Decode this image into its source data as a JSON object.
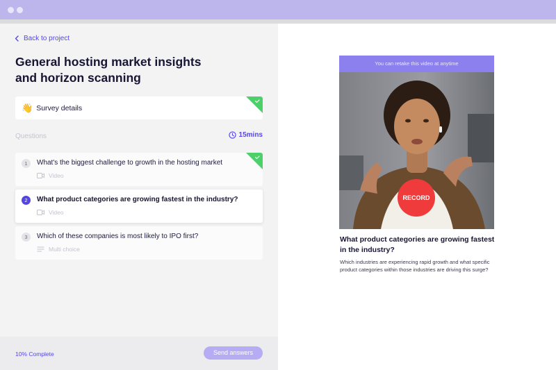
{
  "nav": {
    "back_label": "Back to project"
  },
  "survey": {
    "title": "General hosting market insights and horizon scanning",
    "details_emoji": "👋",
    "details_label": "Survey details"
  },
  "questions_section": {
    "title": "Questions",
    "duration": "15mins"
  },
  "questions": [
    {
      "number": "1",
      "text": "What's the biggest challenge to growth in the hosting market",
      "type": "Video",
      "completed": true,
      "active": false
    },
    {
      "number": "2",
      "text": "What product categories are growing fastest in the industry?",
      "type": "Video",
      "completed": false,
      "active": true
    },
    {
      "number": "3",
      "text": "Which of these companies is most likely to IPO first?",
      "type": "Multi choice",
      "completed": false,
      "active": false
    }
  ],
  "footer": {
    "progress": "10% Complete",
    "send_label": "Send answers"
  },
  "recorder": {
    "banner": "You can retake this video at anytime",
    "record_label": "RECORD",
    "question": "What product categories are growing fastest in the industry?",
    "description": "Which industries are experiencing rapid growth and what specific product categories within those industries are driving this surge?"
  },
  "colors": {
    "accent": "#5546e3",
    "banner": "#8b80ee",
    "check_green": "#4cd16a",
    "record_red": "#ef3b3b"
  }
}
